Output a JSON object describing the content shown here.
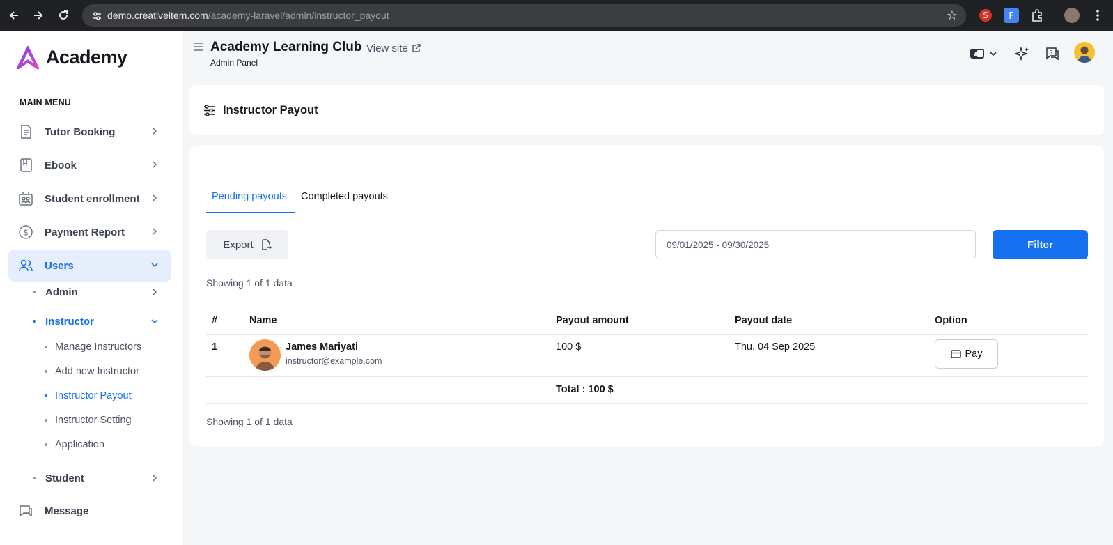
{
  "browser": {
    "url_host": "demo.creativeitem.com",
    "url_path": "/academy-laravel/admin/instructor_payout"
  },
  "logo": {
    "text": "Academy"
  },
  "sidebar": {
    "menu_title": "MAIN MENU",
    "items": [
      {
        "label": "Tutor Booking",
        "icon": "document-icon"
      },
      {
        "label": "Ebook",
        "icon": "book-icon"
      },
      {
        "label": "Student enrollment",
        "icon": "enrollment-icon"
      },
      {
        "label": "Payment Report",
        "icon": "dollar-icon"
      },
      {
        "label": "Users",
        "icon": "users-icon"
      },
      {
        "label": "Message",
        "icon": "message-icon"
      }
    ],
    "users_sub": [
      {
        "label": "Admin"
      },
      {
        "label": "Instructor"
      },
      {
        "label": "Student"
      }
    ],
    "instructor_sub": [
      {
        "label": "Manage Instructors"
      },
      {
        "label": "Add new Instructor"
      },
      {
        "label": "Instructor Payout"
      },
      {
        "label": "Instructor Setting"
      },
      {
        "label": "Application"
      }
    ]
  },
  "header": {
    "title": "Academy Learning Club",
    "view_site": "View site",
    "subtitle": "Admin Panel"
  },
  "page": {
    "title": "Instructor Payout",
    "tabs": [
      {
        "label": "Pending payouts"
      },
      {
        "label": "Completed payouts"
      }
    ],
    "export_label": "Export",
    "date_range": "09/01/2025 - 09/30/2025",
    "filter_label": "Filter",
    "showing_top": "Showing 1 of 1 data",
    "showing_bottom": "Showing 1 of 1 data"
  },
  "table": {
    "columns": [
      "#",
      "Name",
      "Payout amount",
      "Payout date",
      "Option"
    ],
    "rows": [
      {
        "index": "1",
        "name": "James Mariyati",
        "email": "instructor@example.com",
        "amount": "100 $",
        "date": "Thu, 04 Sep 2025",
        "option": "Pay"
      }
    ],
    "total": "Total : 100 $"
  },
  "colors": {
    "accent": "#1570ef",
    "sidebar_active_bg": "#e6eefb",
    "page_bg": "#f5f6f8"
  }
}
